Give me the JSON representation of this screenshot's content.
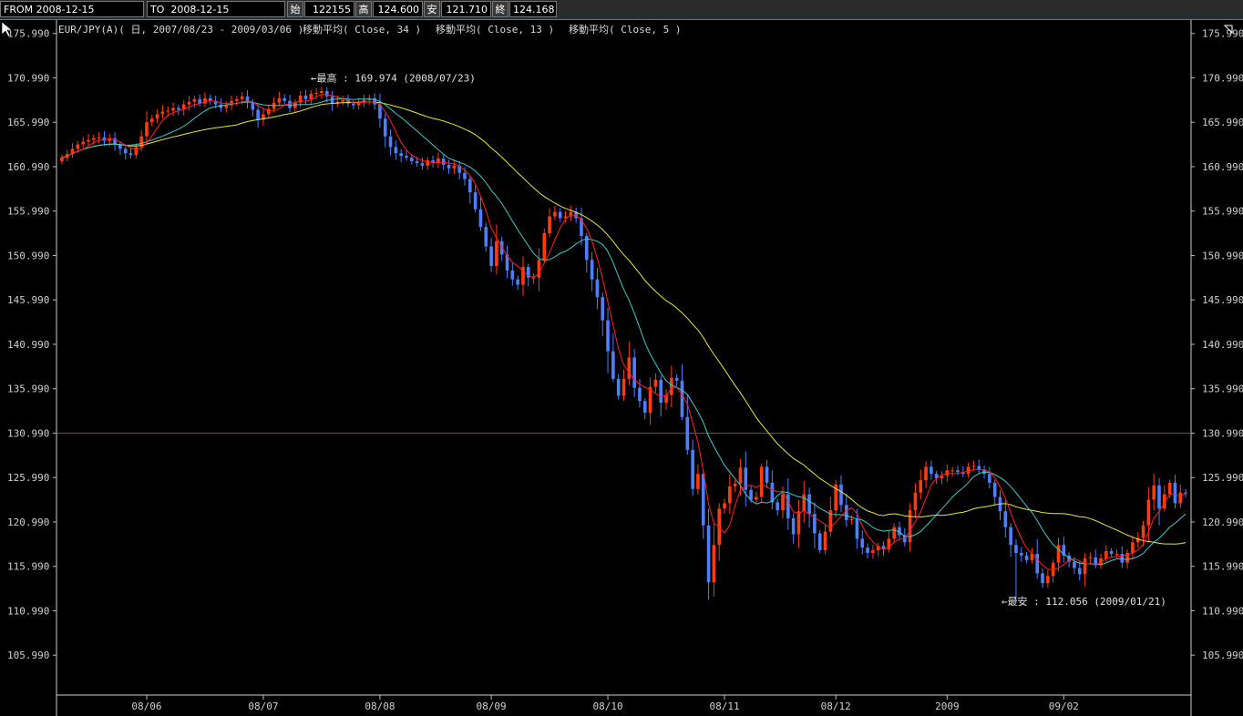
{
  "header": {
    "from_label": "FROM",
    "from_date": "2008-12-15",
    "to_label": "TO",
    "to_date": "2008-12-15",
    "open_label": "始",
    "open_value": "122155",
    "high_label": "高",
    "high_value": "124.600",
    "low_label": "安",
    "low_value": "121.710",
    "close_label": "終",
    "close_value": "124.168"
  },
  "legend": {
    "symbol": "EUR/JPY(A)( 日, 2007/08/23 - 2009/03/06 )",
    "ma34": "移動平均( Close, 34 )",
    "ma13": "移動平均( Close, 13 )",
    "ma5": "移動平均( Close, 5 )"
  },
  "annotations": {
    "high": "←最高 : 169.974 (2008/07/23)",
    "low": "←最安 : 112.056 (2009/01/21)"
  },
  "chart_data": {
    "type": "candlestick",
    "title": "EUR/JPY(A)( 日, 2007/08/23 - 2009/03/06 )",
    "yticks": [
      "175.990",
      "170.990",
      "165.990",
      "160.990",
      "155.990",
      "150.990",
      "145.990",
      "140.990",
      "135.990",
      "130.990",
      "125.990",
      "120.990",
      "115.990",
      "110.990",
      "105.990"
    ],
    "ylim": [
      101.5,
      177.5
    ],
    "xticks": [
      "08/06",
      "08/07",
      "08/08",
      "08/09",
      "08/10",
      "08/11",
      "08/12",
      "2009",
      "09/02"
    ],
    "xtick_index": [
      16,
      38,
      60,
      81,
      103,
      125,
      146,
      167,
      189
    ],
    "reference_line": 130.99,
    "high_point": {
      "value": 169.974,
      "date": "2008/07/23",
      "index": 49
    },
    "low_point": {
      "value": 112.056,
      "date": "2009/01/21",
      "index": 180
    },
    "series_closes": [
      162,
      162.4,
      163,
      163.5,
      163.8,
      164,
      164.2,
      164.3,
      163.9,
      164.2,
      163.5,
      163,
      162.5,
      162.3,
      163.2,
      164.4,
      166,
      166.4,
      166.9,
      167.2,
      167.3,
      167.6,
      167.4,
      168,
      168.3,
      168.6,
      168.1,
      168.7,
      168.4,
      168,
      167.6,
      167.9,
      168.4,
      168.6,
      168.9,
      168.2,
      167.4,
      166.3,
      166.9,
      167.5,
      168.2,
      168.7,
      168.4,
      167.6,
      168.2,
      169,
      168.6,
      169.2,
      169.3,
      169.5,
      168.9,
      168.1,
      168.3,
      168.5,
      168.1,
      167.9,
      168.2,
      168.5,
      168.7,
      168,
      166.4,
      164.4,
      163.2,
      162.5,
      162.2,
      162,
      161.6,
      161.4,
      161.1,
      161.7,
      161.4,
      161.9,
      161.2,
      160.8,
      161.1,
      160.3,
      159.6,
      158.1,
      156.2,
      154.2,
      152,
      149.8,
      152.6,
      151.1,
      149.3,
      148.3,
      147.7,
      149.7,
      148.5,
      148.5,
      150.5,
      153.5,
      155.4,
      155.9,
      155.2,
      155.4,
      155.9,
      155.2,
      153.2,
      150.5,
      148.3,
      146.3,
      143.7,
      140.2,
      137.1,
      135.2,
      137.1,
      139.5,
      136.1,
      134.6,
      133.3,
      136.2,
      137,
      134.4,
      135.3,
      137.2,
      136.9,
      132.8,
      129.1,
      124.7,
      126.4,
      120.6,
      114.2,
      118.4,
      122.5,
      123.1,
      125,
      125.3,
      127.1,
      124.6,
      123.5,
      123.8,
      127.2,
      125.4,
      123.2,
      122.3,
      124.1,
      121.4,
      119.6,
      122.2,
      124.1,
      121.9,
      119.7,
      117.8,
      119.9,
      122.3,
      125.2,
      122.9,
      121.2,
      121.3,
      119.1,
      118.1,
      117.5,
      117.8,
      118.3,
      117.9,
      119.1,
      120.4,
      119.5,
      118.7,
      122.3,
      124.3,
      125.7,
      127.2,
      126.4,
      125.9,
      126.2,
      126.8,
      126.8,
      126.6,
      126.4,
      127.2,
      127.3,
      126.9,
      126.4,
      125.4,
      123.8,
      122.2,
      120.4,
      118.4,
      117.5,
      117.2,
      116.7,
      117.4,
      115.2,
      114.1,
      114.9,
      116.4,
      118.4,
      117.2,
      116.5,
      115.8,
      115.1,
      116.9,
      117,
      116.1,
      116.9,
      117.7,
      117.4,
      117.4,
      116.4,
      117.5,
      118.7,
      119.2,
      120.6,
      123.5,
      125.1,
      122.5,
      124.1,
      125.4,
      123.1,
      124.3,
      124.2
    ]
  },
  "colors": {
    "up": "#ff3b10",
    "down": "#4d7fff",
    "ma34": "#e6e640",
    "ma13": "#40c8c8",
    "ma5": "#ff2020",
    "refline": "#d02020",
    "grid_tick": "#bbbbbb",
    "frame": "#cccccc"
  }
}
